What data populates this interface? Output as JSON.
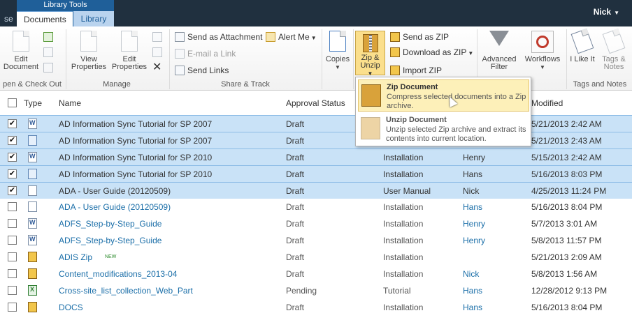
{
  "top": {
    "context_group": "Library Tools",
    "tab_cut": "se",
    "tabs": [
      "Documents",
      "Library"
    ],
    "user": "Nick"
  },
  "ribbon": {
    "edit_document": "Edit Document",
    "view_properties": "View Properties",
    "edit_properties": "Edit Properties",
    "send_as_attachment": "Send as Attachment",
    "email_link": "E-mail a Link",
    "send_links": "Send Links",
    "alert_me": "Alert Me",
    "copies": "Copies",
    "zip_unzip": "Zip & Unzip",
    "send_as_zip": "Send as ZIP",
    "download_as_zip": "Download as ZIP",
    "import_zip": "Import ZIP",
    "advanced_filter": "Advanced Filter",
    "workflows": "Workflows",
    "i_like_it": "I Like It",
    "tags_notes": "Tags & Notes",
    "groups": {
      "open_checkout": "pen & Check Out",
      "manage": "Manage",
      "share_track": "Share & Track",
      "tags_notes": "Tags and Notes"
    }
  },
  "dropdown": {
    "zip_title": "Zip Document",
    "zip_desc": "Compress selected documents into a Zip archive.",
    "unzip_title": "Unzip Document",
    "unzip_desc": "Unzip selected Zip archive and extract its contents into current location."
  },
  "columns": {
    "type": "Type",
    "name": "Name",
    "approval": "Approval Status",
    "modified": "Modified"
  },
  "rows": [
    {
      "sel": true,
      "type": "word",
      "name": "AD Information Sync Tutorial for SP 2007",
      "approval": "Draft",
      "category": "",
      "person": "",
      "modified": "5/21/2013 2:42 AM"
    },
    {
      "sel": true,
      "type": "img",
      "name": "AD Information Sync Tutorial for SP 2007",
      "approval": "Draft",
      "category": "",
      "person": "",
      "modified": "5/21/2013 2:43 AM"
    },
    {
      "sel": true,
      "type": "word",
      "name": "AD Information Sync Tutorial for SP 2010",
      "approval": "Draft",
      "category": "Installation",
      "person": "Henry",
      "modified": "5/15/2013 2:42 AM"
    },
    {
      "sel": true,
      "type": "img",
      "name": "AD Information Sync Tutorial for SP 2010",
      "approval": "Draft",
      "category": "Installation",
      "person": "Hans",
      "modified": "5/16/2013 8:03 PM"
    },
    {
      "sel": true,
      "type": "doc",
      "name": "ADA - User Guide (20120509)",
      "approval": "Draft",
      "category": "User Manual",
      "person": "Nick",
      "modified": "4/25/2013 11:24 PM"
    },
    {
      "sel": false,
      "type": "doc",
      "name": "ADA - User Guide (20120509)",
      "approval": "Draft",
      "category": "Installation",
      "person": "Hans",
      "modified": "5/16/2013 8:04 PM"
    },
    {
      "sel": false,
      "type": "word",
      "name": "ADFS_Step-by-Step_Guide",
      "approval": "Draft",
      "category": "Installation",
      "person": "Henry",
      "modified": "5/7/2013 3:01 AM"
    },
    {
      "sel": false,
      "type": "word",
      "name": "ADFS_Step-by-Step_Guide",
      "approval": "Draft",
      "category": "Installation",
      "person": "Henry",
      "modified": "5/8/2013 11:57 PM"
    },
    {
      "sel": false,
      "type": "zip",
      "name": "ADIS Zip",
      "badge": "NEW",
      "approval": "Draft",
      "category": "Installation",
      "person": "",
      "modified": "5/21/2013 2:09 AM"
    },
    {
      "sel": false,
      "type": "zip",
      "name": "Content_modifications_2013-04",
      "approval": "Draft",
      "category": "Installation",
      "person": "Nick",
      "modified": "5/8/2013 1:56 AM"
    },
    {
      "sel": false,
      "type": "xls",
      "name": "Cross-site_list_collection_Web_Part",
      "approval": "Pending",
      "category": "Tutorial",
      "person": "Hans",
      "modified": "12/28/2012 9:13 PM"
    },
    {
      "sel": false,
      "type": "zip",
      "name": "DOCS",
      "approval": "Draft",
      "category": "Installation",
      "person": "Hans",
      "modified": "5/16/2013 8:04 PM"
    }
  ]
}
